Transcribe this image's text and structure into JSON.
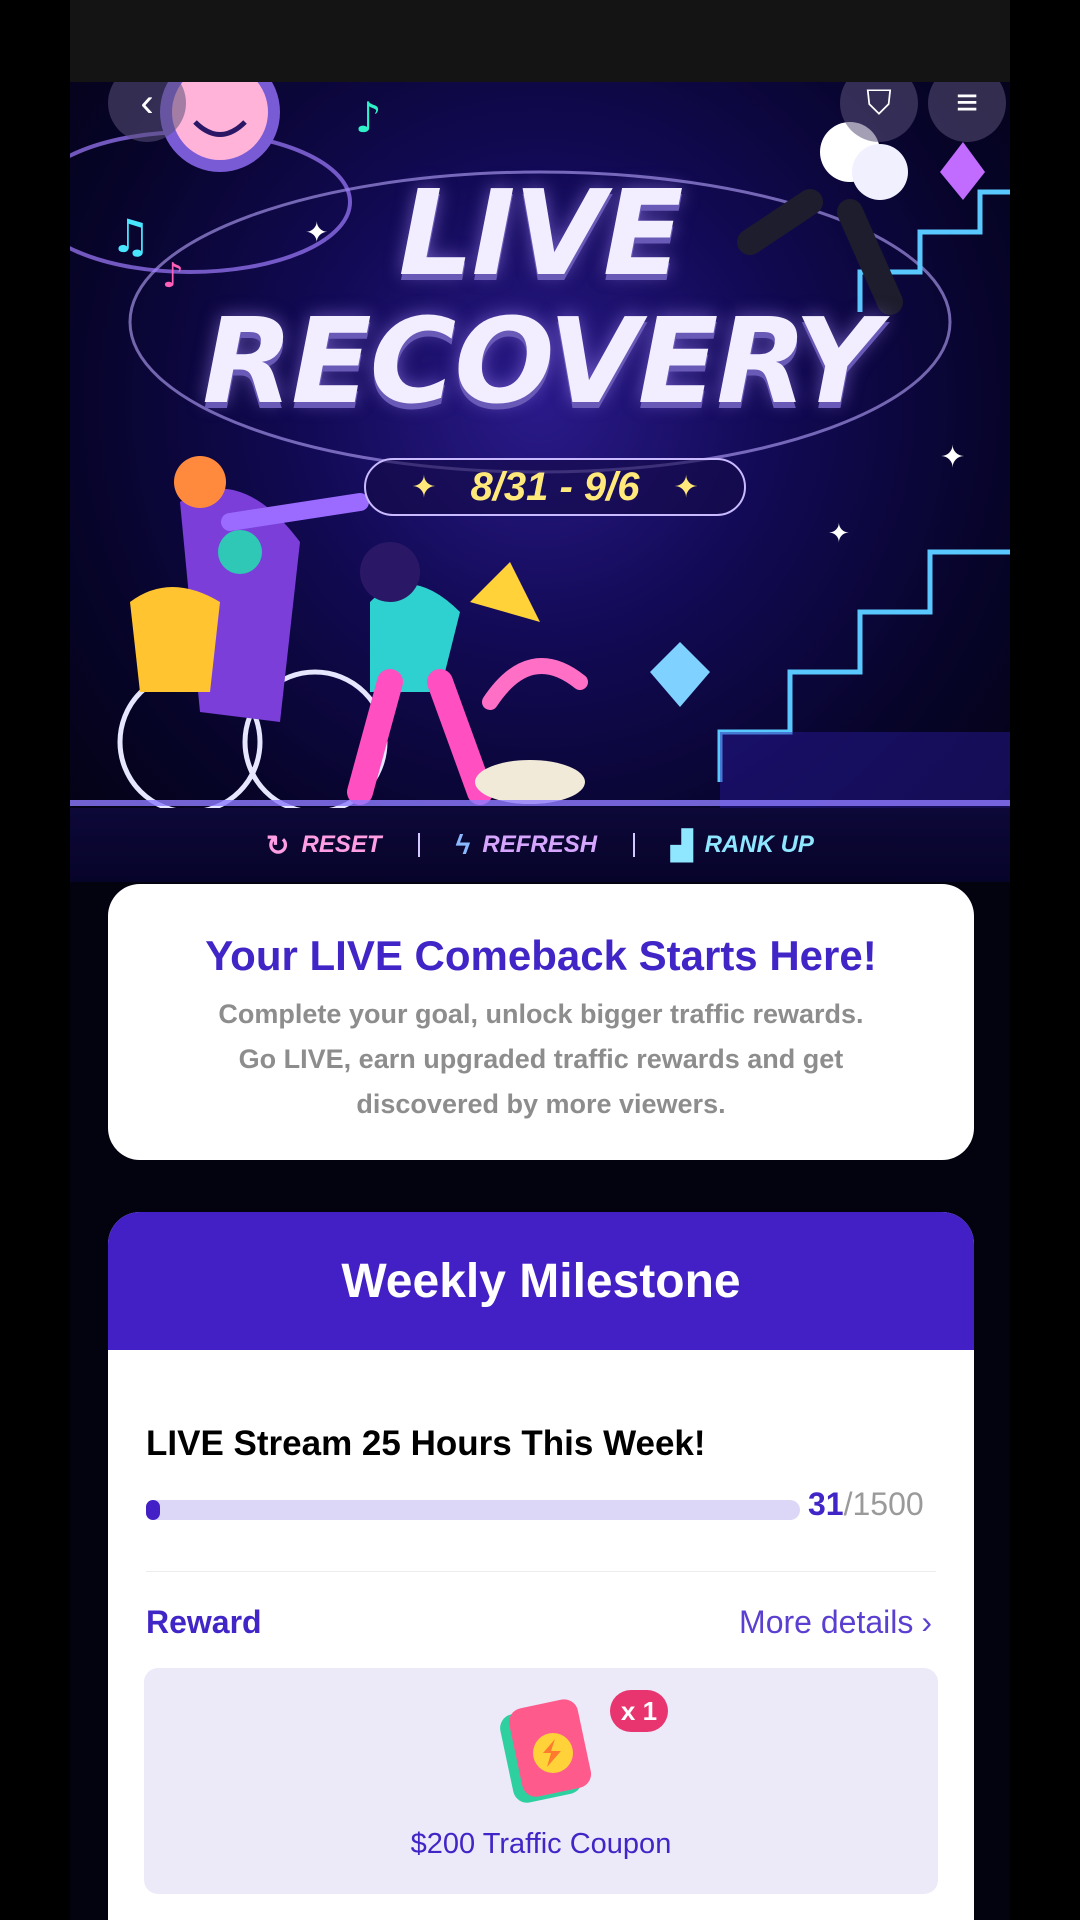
{
  "header": {
    "back_icon": "chevron-left-icon",
    "badge_icon": "shield-star-icon",
    "menu_icon": "hamburger-menu-icon"
  },
  "hero": {
    "title_line1": "LIVE",
    "title_line2": "RECOVERY",
    "date_range": "8/31 - 9/6",
    "tags": [
      {
        "label": "RESET",
        "icon": "refresh-icon"
      },
      {
        "label": "REFRESH",
        "icon": "lightning-icon"
      },
      {
        "label": "RANK UP",
        "icon": "rank-chart-icon"
      }
    ]
  },
  "intro": {
    "title": "Your LIVE Comeback Starts Here!",
    "line1": "Complete your goal, unlock bigger traffic rewards.",
    "line2": "Go LIVE, earn upgraded traffic rewards and get",
    "line3": "discovered by more viewers."
  },
  "milestone": {
    "title": "Weekly Milestone",
    "goal": "LIVE Stream 25 Hours This Week!",
    "progress_current": "31",
    "progress_separator": "/",
    "progress_total": "1500",
    "progress_fraction": 0.0207,
    "reward_label": "Reward",
    "more_details": "More details",
    "reward": {
      "quantity": "x 1",
      "name": "$200 Traffic Coupon",
      "icon": "traffic-coupon-icon"
    }
  },
  "colors": {
    "accent": "#4320c6",
    "badge": "#e8346f",
    "date": "#ffe97a"
  }
}
